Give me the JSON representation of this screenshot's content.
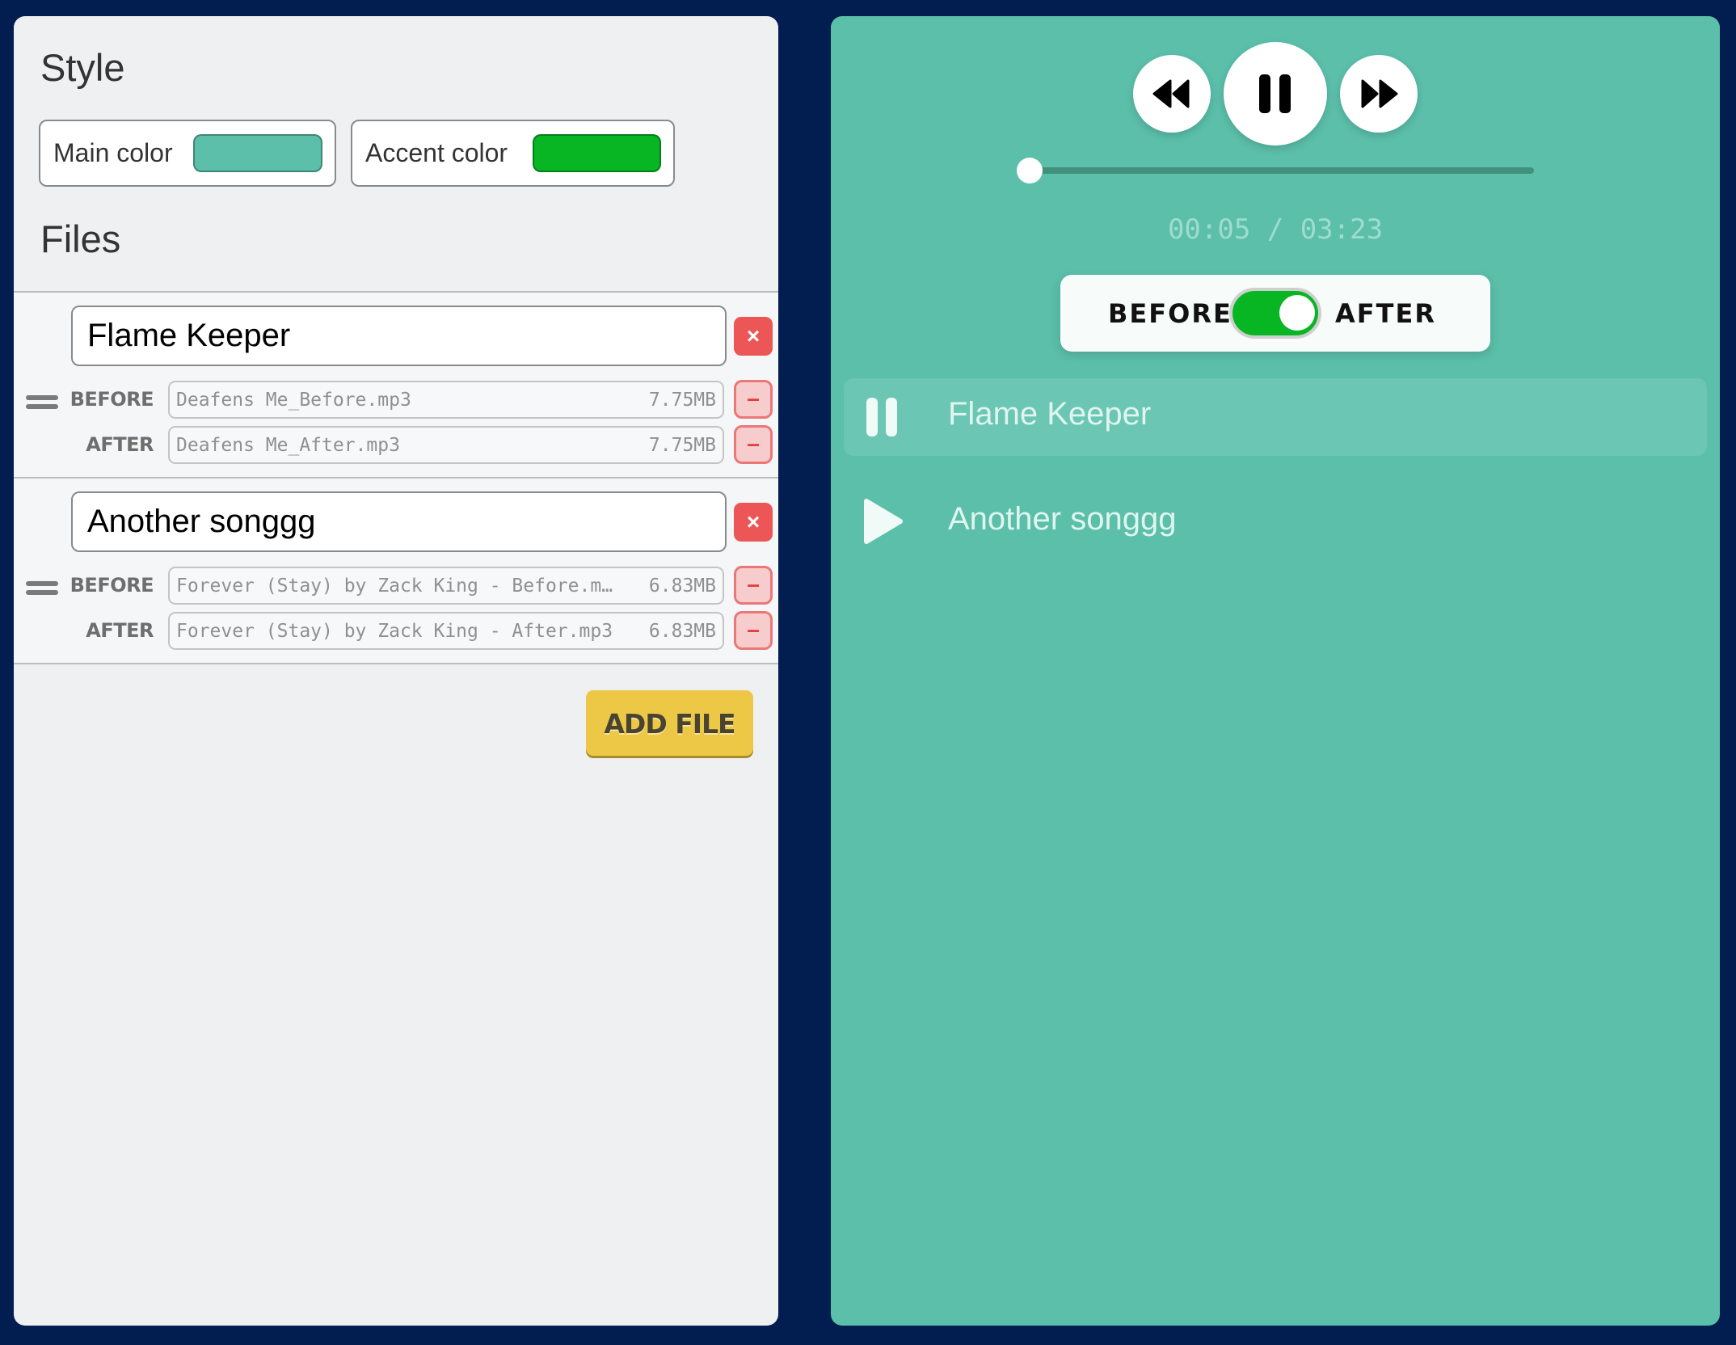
{
  "style_section": {
    "title": "Style",
    "main_color": {
      "label": "Main color",
      "value": "#5bbfaa"
    },
    "accent_color": {
      "label": "Accent color",
      "value": "#08b624"
    }
  },
  "files_section": {
    "title": "Files",
    "groups": [
      {
        "name": "Flame Keeper",
        "before": {
          "label": "BEFORE",
          "filename": "Deafens Me_Before.mp3",
          "size": "7.75MB"
        },
        "after": {
          "label": "AFTER",
          "filename": "Deafens Me_After.mp3",
          "size": "7.75MB"
        }
      },
      {
        "name": "Another songgg",
        "before": {
          "label": "BEFORE",
          "filename": "Forever (Stay) by Zack King - Before.m…",
          "size": "6.83MB"
        },
        "after": {
          "label": "AFTER",
          "filename": "Forever (Stay) by Zack King - After.mp3",
          "size": "6.83MB"
        }
      }
    ],
    "delete_glyph": "×",
    "remove_glyph": "–",
    "add_file_label": "ADD FILE"
  },
  "player": {
    "controls": {
      "rewind_icon": "rewind-icon",
      "pause_icon": "pause-icon",
      "forward_icon": "fast-forward-icon"
    },
    "progress_fraction": 0.025,
    "time_display": "00:05 / 03:23",
    "ab_toggle": {
      "before_label": "BEFORE",
      "after_label": "AFTER",
      "state": "after"
    },
    "tracks": [
      {
        "title": "Flame Keeper",
        "state": "playing",
        "icon": "pause-icon"
      },
      {
        "title": "Another songgg",
        "state": "stopped",
        "icon": "play-icon"
      }
    ]
  }
}
